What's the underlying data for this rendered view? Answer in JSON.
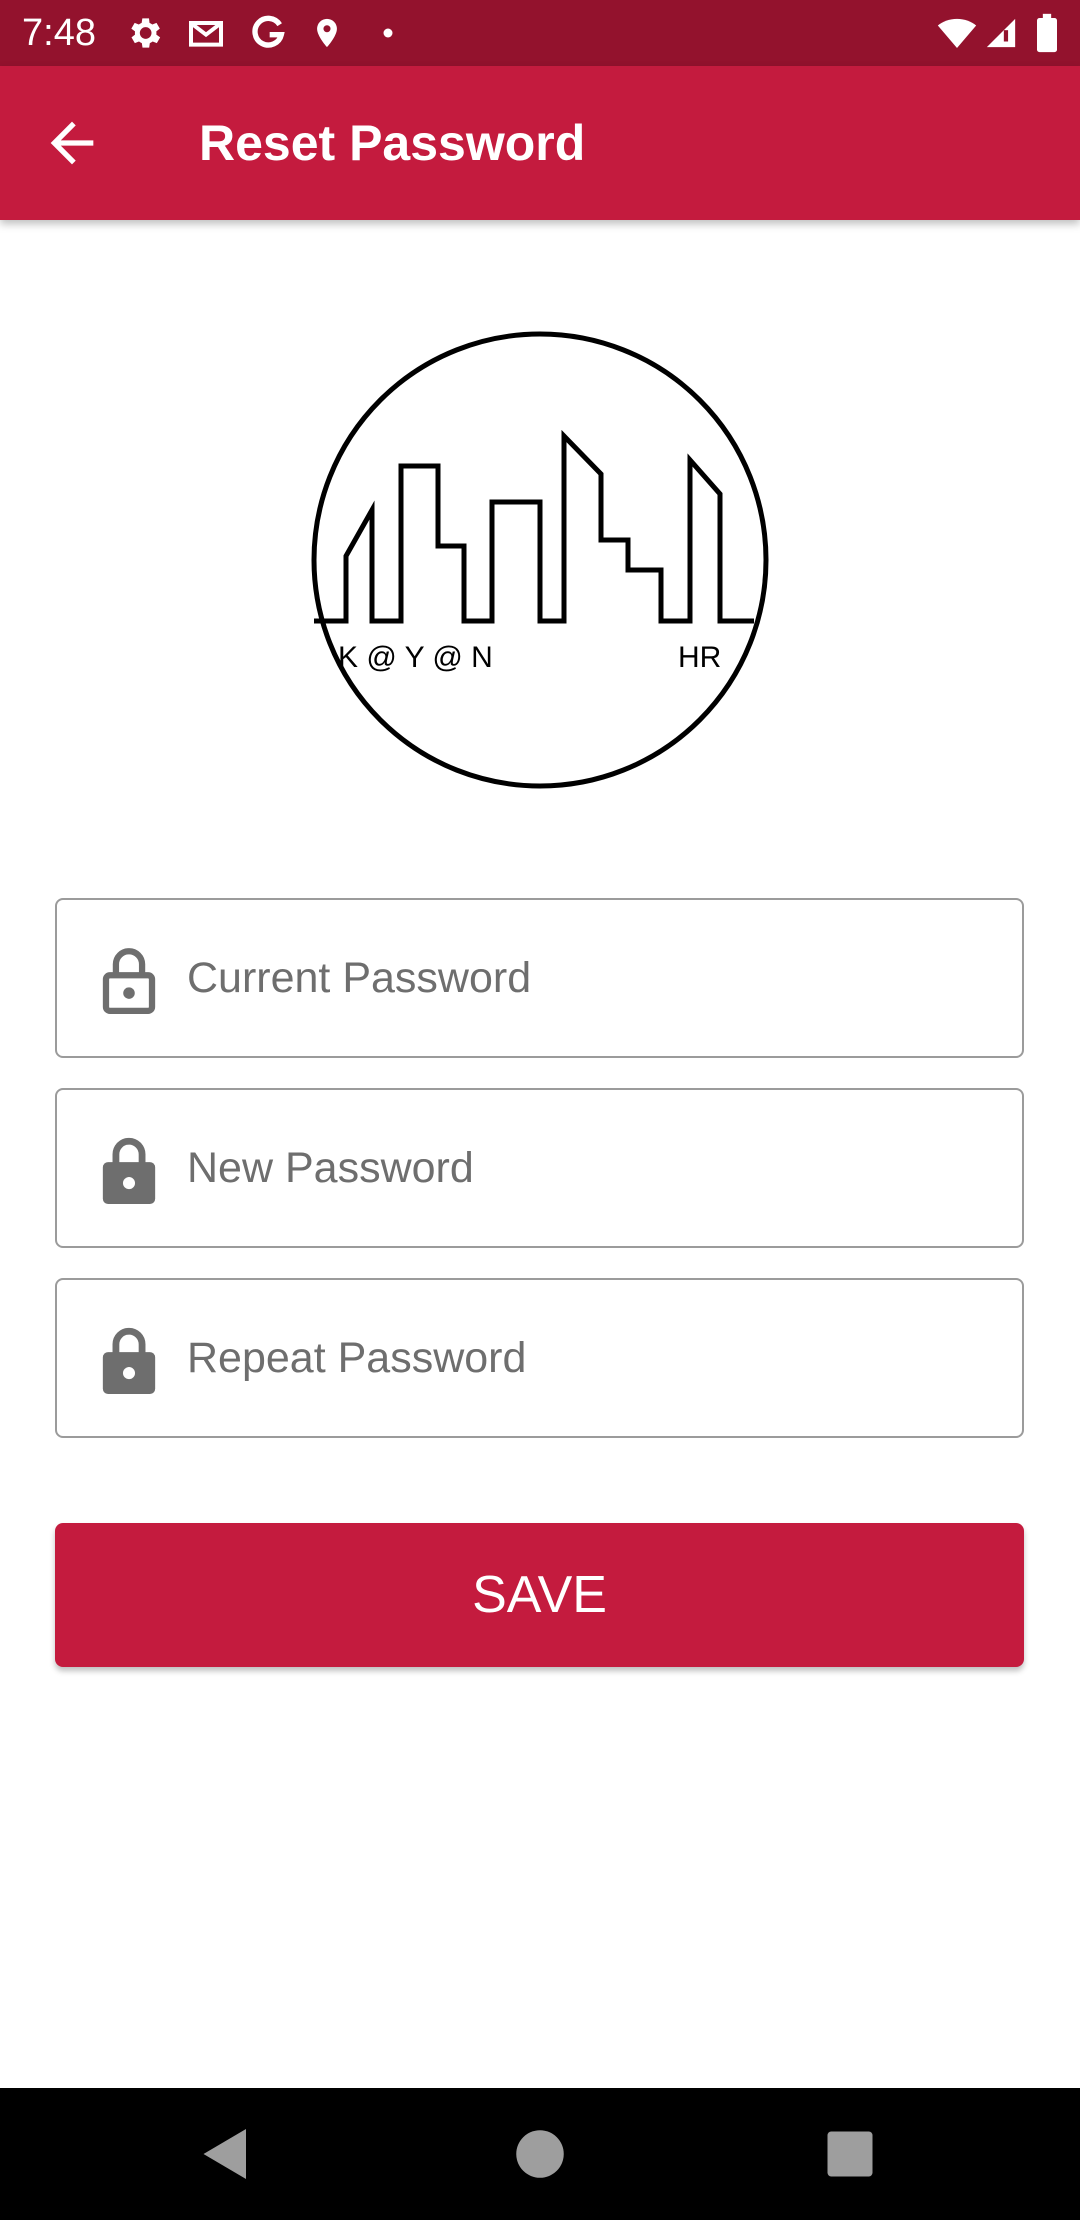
{
  "status_bar": {
    "time": "7:48",
    "left_icons": [
      "gear-icon",
      "gmail-icon",
      "google-icon",
      "location-pin-icon",
      "dot-icon"
    ],
    "right_icons": [
      "wifi-icon",
      "signal-icon",
      "battery-icon"
    ]
  },
  "app_bar": {
    "title": "Reset Password",
    "back_icon": "arrow-back-icon"
  },
  "logo": {
    "text_left": "K @ Y @ N",
    "text_right": "HR"
  },
  "form": {
    "current_password": {
      "placeholder": "Current Password",
      "value": "",
      "icon": "lock-open-icon"
    },
    "new_password": {
      "placeholder": "New Password",
      "value": "",
      "icon": "lock-icon"
    },
    "repeat_password": {
      "placeholder": "Repeat Password",
      "value": "",
      "icon": "lock-icon"
    }
  },
  "save_button": {
    "label": "SAVE"
  },
  "nav_bar": {
    "buttons": [
      "back-triangle-icon",
      "home-circle-icon",
      "recents-square-icon"
    ]
  },
  "colors": {
    "status_bar": "#93122d",
    "primary": "#c41b3e",
    "field_border": "#9b9b9b",
    "placeholder": "#6e6e6e",
    "nav_bar": "#000000"
  }
}
